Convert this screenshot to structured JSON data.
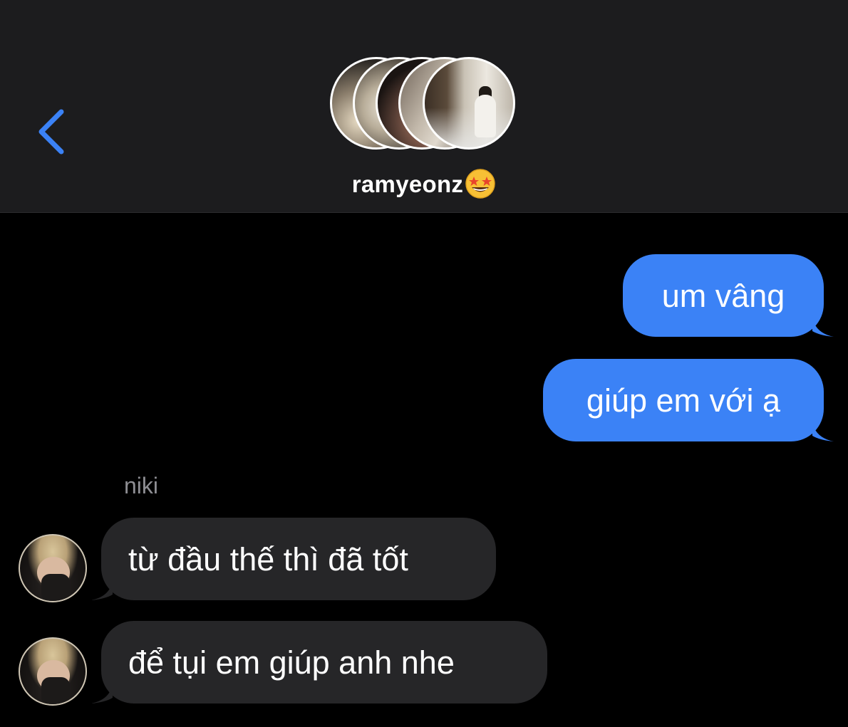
{
  "header": {
    "back_icon": "chevron-left-icon",
    "contact_name": "ramyeonz",
    "contact_emoji": "star-struck-emoji",
    "group_avatar_count": 5
  },
  "messages": [
    {
      "direction": "outgoing",
      "text": "um vâng"
    },
    {
      "direction": "outgoing",
      "text": "giúp em với ạ"
    },
    {
      "direction": "incoming",
      "sender": "niki",
      "text": "từ đầu thế thì đã tốt"
    },
    {
      "direction": "incoming",
      "text": "để tụi em giúp anh nhe"
    }
  ],
  "colors": {
    "header_bg": "#1c1c1e",
    "background": "#000000",
    "outgoing_bubble": "#3b82f6",
    "incoming_bubble": "#262628",
    "accent": "#3b82f6",
    "sender_name": "#8e8e93"
  }
}
